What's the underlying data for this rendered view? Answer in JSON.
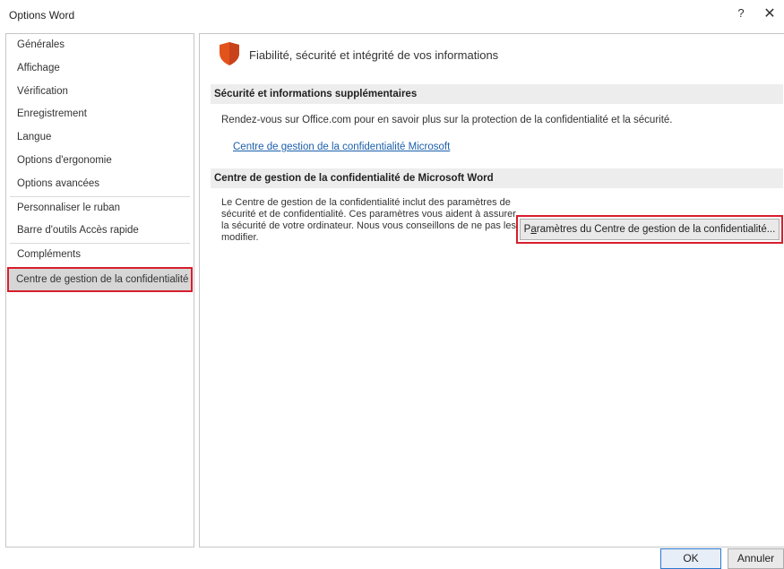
{
  "window": {
    "title": "Options Word",
    "help_glyph": "?",
    "close_glyph": "✕"
  },
  "sidebar": {
    "items": [
      {
        "label": "Générales"
      },
      {
        "label": "Affichage"
      },
      {
        "label": "Vérification"
      },
      {
        "label": "Enregistrement"
      },
      {
        "label": "Langue"
      },
      {
        "label": "Options d'ergonomie"
      },
      {
        "label": "Options avancées"
      },
      {
        "label": "Personnaliser le ruban"
      },
      {
        "label": "Barre d'outils Accès rapide"
      },
      {
        "label": "Compléments"
      },
      {
        "label": "Centre de gestion de la confidentialité",
        "selected": true
      }
    ]
  },
  "main": {
    "header_title": "Fiabilité, sécurité et intégrité de vos informations",
    "header_icon": "shield-icon",
    "section1_title": "Sécurité et informations supplémentaires",
    "section1_text": "Rendez-vous sur Office.com pour en savoir plus sur la protection de la confidentialité et la sécurité.",
    "section1_link": "Centre de gestion de la confidentialité Microsoft",
    "section2_title": "Centre de gestion de la confidentialité de Microsoft Word",
    "section2_text": "Le Centre de gestion de la confidentialité inclut des paramètres de sécurité et de confidentialité. Ces paramètres vous aident à assurer la sécurité de votre ordinateur. Nous vous conseillons de ne pas les modifier.",
    "trust_center_button_prefix": "P",
    "trust_center_button_access_key": "a",
    "trust_center_button_rest": "ramètres du Centre de gestion de la confidentialité..."
  },
  "footer": {
    "ok_label": "OK",
    "cancel_label": "Annuler"
  },
  "colors": {
    "accent_link": "#1b5fab",
    "highlight_red": "#d81e2c",
    "shield_orange": "#e2531c",
    "ok_border": "#2b79d0"
  }
}
